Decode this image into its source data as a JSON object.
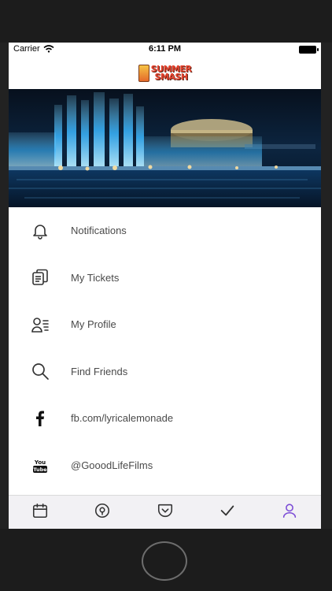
{
  "status_bar": {
    "carrier": "Carrier",
    "time": "6:11 PM"
  },
  "header": {
    "logo_line1": "SUMMER",
    "logo_line2": "SMASH"
  },
  "menu": {
    "items": [
      {
        "label": "Notifications",
        "icon": "bell-icon"
      },
      {
        "label": "My Tickets",
        "icon": "ticket-icon"
      },
      {
        "label": "My Profile",
        "icon": "profile-icon"
      },
      {
        "label": "Find Friends",
        "icon": "search-icon"
      },
      {
        "label": "fb.com/lyricalemonade",
        "icon": "facebook-icon"
      },
      {
        "label": "@GooodLifeFilms",
        "icon": "youtube-icon"
      }
    ]
  },
  "tabbar": {
    "tabs": [
      {
        "icon": "calendar-icon"
      },
      {
        "icon": "map-pin-icon"
      },
      {
        "icon": "pocket-icon"
      },
      {
        "icon": "checkmark-icon"
      },
      {
        "icon": "user-icon",
        "active": true
      }
    ],
    "active_color": "#7b4bd6",
    "inactive_color": "#333333"
  }
}
